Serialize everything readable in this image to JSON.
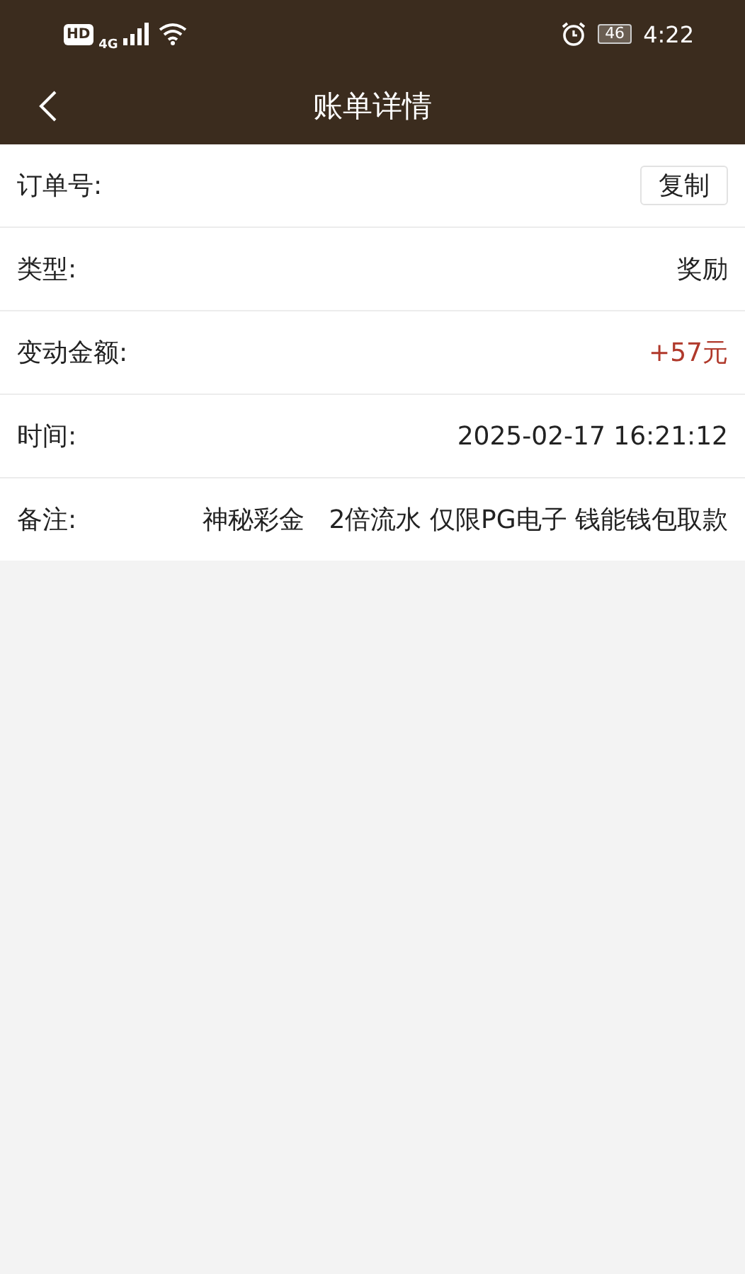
{
  "status_bar": {
    "hd": "HD",
    "network": "4G",
    "battery": "46",
    "time": "4:22"
  },
  "title_bar": {
    "title": "账单详情"
  },
  "rows": [
    {
      "kind": "button",
      "label": "订单号:",
      "button": "复制"
    },
    {
      "kind": "text",
      "label": "类型:",
      "value": "奖励"
    },
    {
      "kind": "amount",
      "label": "变动金额:",
      "value": "+57元"
    },
    {
      "kind": "text",
      "label": "时间:",
      "value": "2025-02-17 16:21:12"
    },
    {
      "kind": "text",
      "label": "备注:",
      "value": "神秘彩金   2倍流水 仅限PG电子 钱能钱包取款"
    }
  ]
}
